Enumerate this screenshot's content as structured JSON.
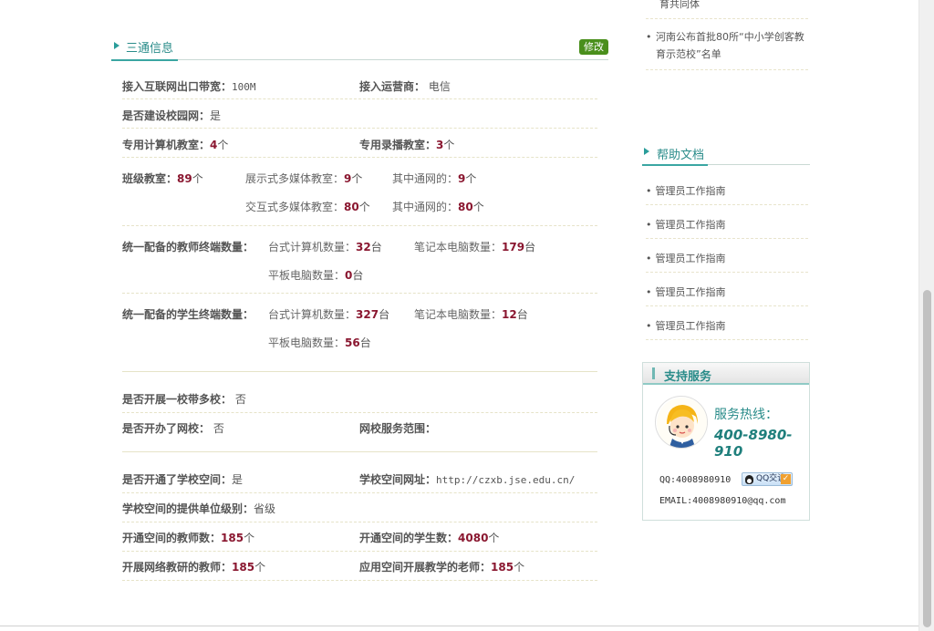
{
  "section": {
    "title": "三通信息",
    "edit_label": "修改"
  },
  "rows": {
    "bandwidth_label": "接入互联网出口带宽：",
    "bandwidth_value": "100M",
    "isp_label": "接入运营商：",
    "isp_value": "电信",
    "campus_net_label": "是否建设校园网：",
    "campus_net_value": "是",
    "computer_room_label": "专用计算机教室：",
    "computer_room_value": "4",
    "computer_room_unit": "个",
    "recording_room_label": "专用录播教室：",
    "recording_room_value": "3",
    "recording_room_unit": "个",
    "class_room_label": "班级教室：",
    "class_room_value": "89",
    "class_room_unit": "个",
    "display_mm_label": "展示式多媒体教室：",
    "display_mm_value": "9",
    "display_mm_unit": "个",
    "display_net_label": "其中通网的：",
    "display_net_value": "9",
    "display_net_unit": "个",
    "interactive_mm_label": "交互式多媒体教室：",
    "interactive_mm_value": "80",
    "interactive_mm_unit": "个",
    "interactive_net_label": "其中通网的：",
    "interactive_net_value": "80",
    "interactive_net_unit": "个",
    "teacher_terminal_label": "统一配备的教师终端数量：",
    "t_desktop_label": "台式计算机数量：",
    "t_desktop_value": "32",
    "t_desktop_unit": "台",
    "t_laptop_label": "笔记本电脑数量：",
    "t_laptop_value": "179",
    "t_laptop_unit": "台",
    "t_tablet_label": "平板电脑数量：",
    "t_tablet_value": "0",
    "t_tablet_unit": "台",
    "student_terminal_label": "统一配备的学生终端数量：",
    "s_desktop_label": "台式计算机数量：",
    "s_desktop_value": "327",
    "s_desktop_unit": "台",
    "s_laptop_label": "笔记本电脑数量：",
    "s_laptop_value": "12",
    "s_laptop_unit": "台",
    "s_tablet_label": "平板电脑数量：",
    "s_tablet_value": "56",
    "s_tablet_unit": "台",
    "one_many_label": "是否开展一校带多校：",
    "one_many_value": "否",
    "net_school_label": "是否开办了网校：",
    "net_school_value": "否",
    "net_scope_label": "网校服务范围：",
    "space_open_label": "是否开通了学校空间：",
    "space_open_value": "是",
    "space_url_label": "学校空间网址：",
    "space_url_value": "http://czxb.jse.edu.cn/",
    "space_level_label": "学校空间的提供单位级别：",
    "space_level_value": "省级",
    "space_teachers_label": "开通空间的教师数：",
    "space_teachers_value": "185",
    "space_teachers_unit": "个",
    "space_students_label": "开通空间的学生数：",
    "space_students_value": "4080",
    "space_students_unit": "个",
    "online_research_label": "开展网络教研的教师：",
    "online_research_value": "185",
    "online_research_unit": "个",
    "space_teaching_label": "应用空间开展教学的老师：",
    "space_teaching_value": "185",
    "space_teaching_unit": "个"
  },
  "sidebar": {
    "news": [
      {
        "text": "育共同体"
      },
      {
        "text": "河南公布首批80所“中小学创客教育示范校”名单"
      }
    ],
    "help_title": "帮助文档",
    "help_items": [
      {
        "label": "管理员工作指南"
      },
      {
        "label": "管理员工作指南"
      },
      {
        "label": "管理员工作指南"
      },
      {
        "label": "管理员工作指南"
      },
      {
        "label": "管理员工作指南"
      }
    ],
    "support": {
      "title": "支持服务",
      "hotline_label": "服务热线：",
      "hotline": "400-8980-910",
      "qq": "QQ:4008980910",
      "qq_button": "QQ交谈",
      "email": "EMAIL:4008980910@qq.com"
    }
  },
  "colors": {
    "accent": "#2a8c8a",
    "value": "#8a1730",
    "edit_button": "#4a8f1c"
  }
}
